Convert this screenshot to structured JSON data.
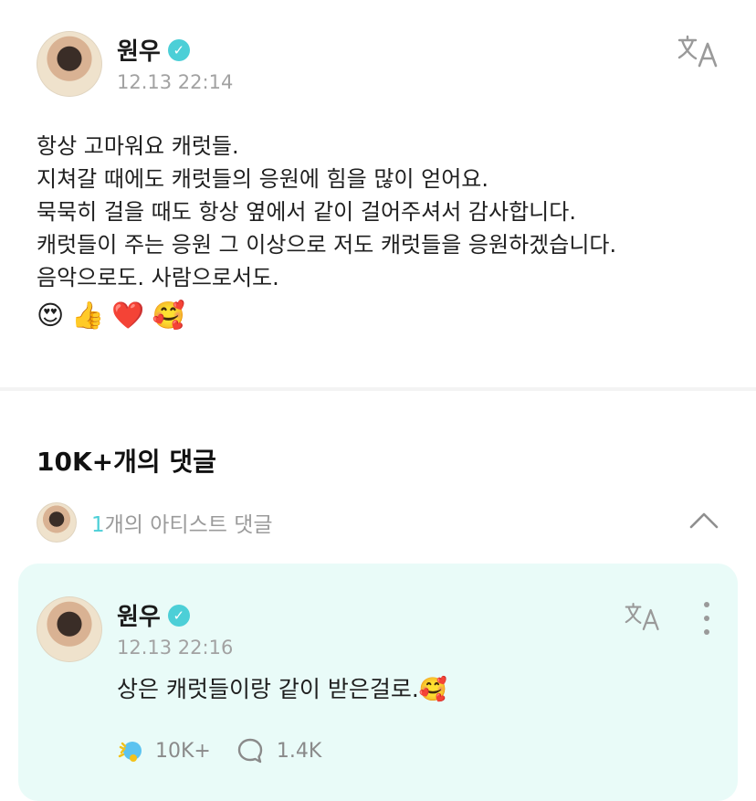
{
  "post": {
    "author": "원우",
    "timestamp": "12.13 22:14",
    "lines": [
      "항상 고마워요 캐럿들.",
      "지쳐갈 때에도 캐럿들의 응원에 힘을 많이 얻어요.",
      "묵묵히 걸을 때도 항상 옆에서 같이 걸어주셔서 감사합니다.",
      "캐럿들이 주는 응원 그 이상으로 저도 캐럿들을 응원하겠습니다.",
      "음악으로도. 사람으로서도."
    ],
    "emojis": [
      "😍",
      "👍",
      "❤️",
      "🥰"
    ]
  },
  "comments": {
    "heading": "10K+개의 댓글",
    "artist_count": "1",
    "artist_label": "개의 아티스트 댓글"
  },
  "artist_comment": {
    "author": "원우",
    "timestamp": "12.13 22:16",
    "text": "상은 캐럿들이랑 같이 받은걸로.🥰",
    "likes": "10K+",
    "replies": "1.4K"
  },
  "icons": {
    "verified": "verified-badge-icon",
    "translate": "translate-icon",
    "collapse": "chevron-up-icon",
    "more": "more-vertical-icon",
    "like": "cheer-like-icon",
    "reply": "comment-bubble-icon"
  },
  "colors": {
    "accent": "#4ccfd7",
    "card_background": "#e9fbf8",
    "muted_text": "#a2a2a2"
  }
}
